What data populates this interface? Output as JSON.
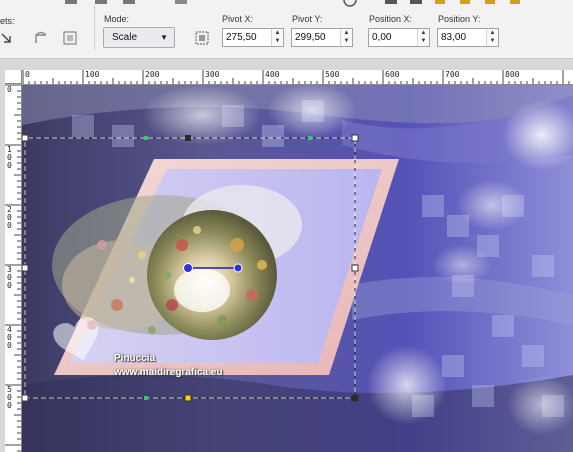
{
  "toolbar": {
    "presets_label": "ets:",
    "mode": {
      "label": "Mode:",
      "value": "Scale"
    },
    "pivot_x": {
      "label": "Pivot X:",
      "value": "275,50"
    },
    "pivot_y": {
      "label": "Pivot Y:",
      "value": "299,50"
    },
    "position_x": {
      "label": "Position X:",
      "value": "0,00"
    },
    "position_y": {
      "label": "Position Y:",
      "value": "83,00"
    }
  },
  "ruler": {
    "top_ticks": [
      "0",
      "100",
      "200",
      "300",
      "400",
      "500",
      "600",
      "700",
      "800"
    ],
    "left_ticks": [
      "0",
      "1\n0\n0",
      "2\n0\n0",
      "3\n0\n0",
      "4\n0\n0",
      "5\n0\n0"
    ]
  },
  "watermark": {
    "name": "Pinuccia",
    "url": "www.maidiregrafica.eu"
  },
  "colors": {
    "accent": "#3b3fb8",
    "frame": "#f3c8c4",
    "background_dark": "#3a3868"
  }
}
